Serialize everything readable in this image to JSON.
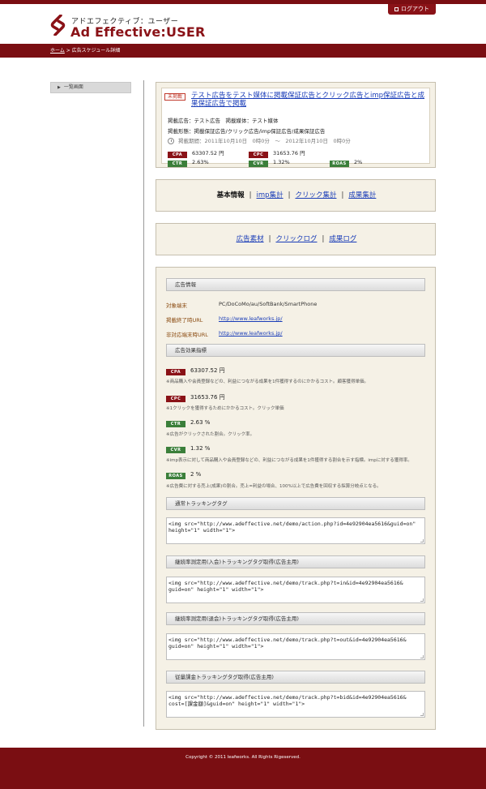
{
  "colors": {
    "brand": "#8a1217",
    "header_bar": "#7a0e12",
    "panel_bg": "#f5f1e6",
    "link": "#1a3db8",
    "tag_red": "#8a1217",
    "tag_green": "#3b7f3a"
  },
  "header": {
    "logo_icon": "ad-effective-logo-icon",
    "logo_subtitle": "アドエフェクティブ：ユーザー",
    "logo_title": "Ad Effective:USER",
    "logout_label": "ログアウト"
  },
  "breadcrumb": {
    "home": "ホーム",
    "separator": " > ",
    "current": "広告スケジュール詳細"
  },
  "sidebar": {
    "back_label": "一覧画面",
    "back_icon": "triangle-right-icon"
  },
  "campaign": {
    "status": "未掲載",
    "title": "テスト広告をテスト媒体に掲載保証広告とクリック広告とimp保証広告と成果保証広告で掲載",
    "meta1": "掲載広告：テスト広告　掲載媒体：テスト媒体",
    "meta2": "掲載形態：掲載保証広告/クリック広告/imp保証広告/成果保証広告",
    "period": "掲載期間：2011年10月10日　0時0分　〜　2012年10月10日　0時0分",
    "metrics": {
      "cpa_label": "CPA",
      "cpa_value": "63307.52 円",
      "cpc_label": "CPC",
      "cpc_value": "31653.76 円",
      "ctr_label": "CTR",
      "ctr_value": "2.63%",
      "cvr_label": "CVR",
      "cvr_value": "1.32%",
      "roas_label": "ROAS",
      "roas_value": "2%"
    }
  },
  "nav1": {
    "current": "基本情報",
    "link1": "imp集計",
    "link2": "クリック集計",
    "link3": "成果集計",
    "sep": "|"
  },
  "nav2": {
    "link1": "広告素材",
    "link2": "クリックログ",
    "link3": "成果ログ",
    "sep": "|"
  },
  "ad_info": {
    "heading": "広告情報",
    "rows": [
      {
        "label": "対象端末",
        "value": "PC/DoCoMo/au/SoftBank/SmartPhone"
      },
      {
        "label": "掲載終了時URL",
        "value": "http://www.leafworks.jp/"
      },
      {
        "label": "非対応端末時URL",
        "value": "http://www.leafworks.jp/"
      }
    ]
  },
  "effects": {
    "heading": "広告効果指標",
    "items": [
      {
        "label": "CPA",
        "value": "63307.52 円",
        "note": "※商品購入や会員登録などの、利益につながる成果を1件獲得するのにかかるコスト。顧客獲得単価。"
      },
      {
        "label": "CPC",
        "value": "31653.76 円",
        "note": "※1クリックを獲得するためにかかるコスト。クリック単価"
      },
      {
        "label": "CTR",
        "value": "2.63 %",
        "note": "※広告がクリックされた割合。クリック率。"
      },
      {
        "label": "CVR",
        "value": "1.32 %",
        "note": "※imp表示に対して商品購入や会員登録などの、利益につながる成果を1件獲得する割合を示す指標。impに対する獲得率。"
      },
      {
        "label": "ROAS",
        "value": "2 %",
        "note": "※広告費に対する売上(成果)の割合。売上=利益の場合、100%以上で広告費を回収する採算分岐点となる。"
      }
    ]
  },
  "tags": [
    {
      "heading": "通常トラッキングタグ",
      "code": "<img src=\"http://www.adeffective.net/demo/action.php?id=4e92904ea5616&guid=on\"\nheight=\"1\" width=\"1\">"
    },
    {
      "heading": "継続率測定用(入会)トラッキングタグ取得(広告主用)",
      "code": "<img src=\"http://www.adeffective.net/demo/track.php?t=in&id=4e92904ea5616&\nguid=on\" height=\"1\" width=\"1\">"
    },
    {
      "heading": "継続率測定用(退会)トラッキングタグ取得(広告主用)",
      "code": "<img src=\"http://www.adeffective.net/demo/track.php?t=out&id=4e92904ea5616&\nguid=on\" height=\"1\" width=\"1\">"
    },
    {
      "heading": "従量課金トラッキングタグ取得(広告主用)",
      "code": "<img src=\"http://www.adeffective.net/demo/track.php?t=bid&id=4e92904ea5616&\ncost=[課金額]&guid=on\" height=\"1\" width=\"1\">"
    }
  ],
  "footer": {
    "copyright": "Copyright © 2011 leafworks. All Rights Rigeserved."
  }
}
